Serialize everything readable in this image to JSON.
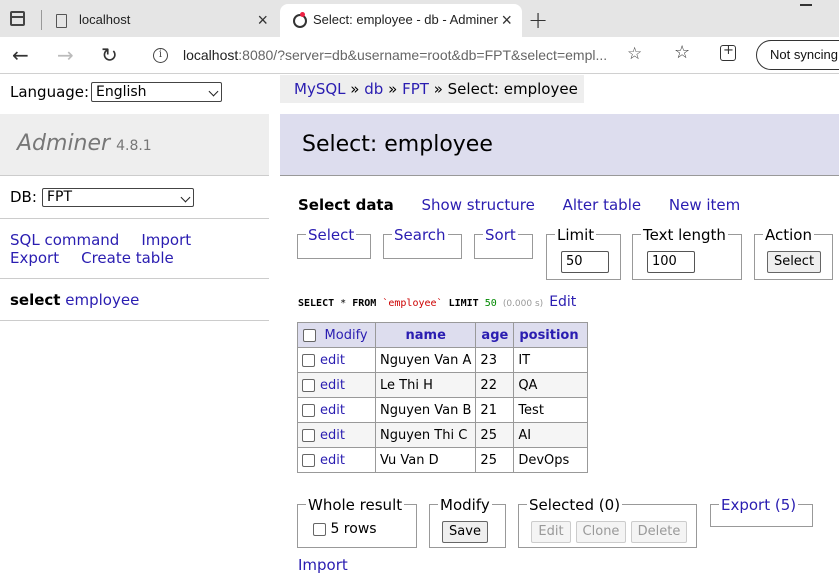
{
  "browser": {
    "tabs": [
      {
        "title": "localhost"
      },
      {
        "title": "Select: employee - db - Adminer"
      }
    ],
    "url_host": "localhost",
    "url_rest": ":8080/?server=db&username=root&db=FPT&select=empl...",
    "sync_label": "Not syncing"
  },
  "sidebar": {
    "language_label": "Language:",
    "language_value": "English",
    "app_name": "Adminer",
    "version": "4.8.1",
    "db_label": "DB:",
    "db_value": "FPT",
    "links": [
      "SQL command",
      "Import",
      "Export",
      "Create table"
    ],
    "table_prefix": "select",
    "table_name": "employee"
  },
  "breadcrumb": {
    "items": [
      "MySQL",
      "db",
      "FPT"
    ],
    "current": "Select: employee",
    "separator": "»"
  },
  "main": {
    "title": "Select: employee",
    "tabs": [
      "Select data",
      "Show structure",
      "Alter table",
      "New item"
    ],
    "filters": {
      "select": "Select",
      "search": "Search",
      "sort": "Sort",
      "limit_label": "Limit",
      "limit_value": "50",
      "text_length_label": "Text length",
      "text_length_value": "100",
      "action_label": "Action",
      "select_button": "Select"
    },
    "sql": {
      "select_kw": "SELECT",
      "star": "*",
      "from_kw": "FROM",
      "table": "`employee`",
      "limit_kw": "LIMIT",
      "limit_value": "50",
      "time": "(0.000 s)",
      "edit": "Edit"
    },
    "table": {
      "modify_header": "Modify",
      "columns": [
        "name",
        "age",
        "position"
      ],
      "row_action": "edit",
      "rows": [
        [
          "Nguyen Van A",
          "23",
          "IT"
        ],
        [
          "Le Thi H",
          "22",
          "QA"
        ],
        [
          "Nguyen Van B",
          "21",
          "Test"
        ],
        [
          "Nguyen Thi C",
          "25",
          "AI"
        ],
        [
          "Vu Van D",
          "25",
          "DevOps"
        ]
      ]
    },
    "footer": {
      "whole_result": "Whole result",
      "rows_label": "5 rows",
      "modify": "Modify",
      "save": "Save",
      "selected": "Selected (0)",
      "edit": "Edit",
      "clone": "Clone",
      "delete": "Delete",
      "export": "Export (5)",
      "import": "Import"
    }
  }
}
